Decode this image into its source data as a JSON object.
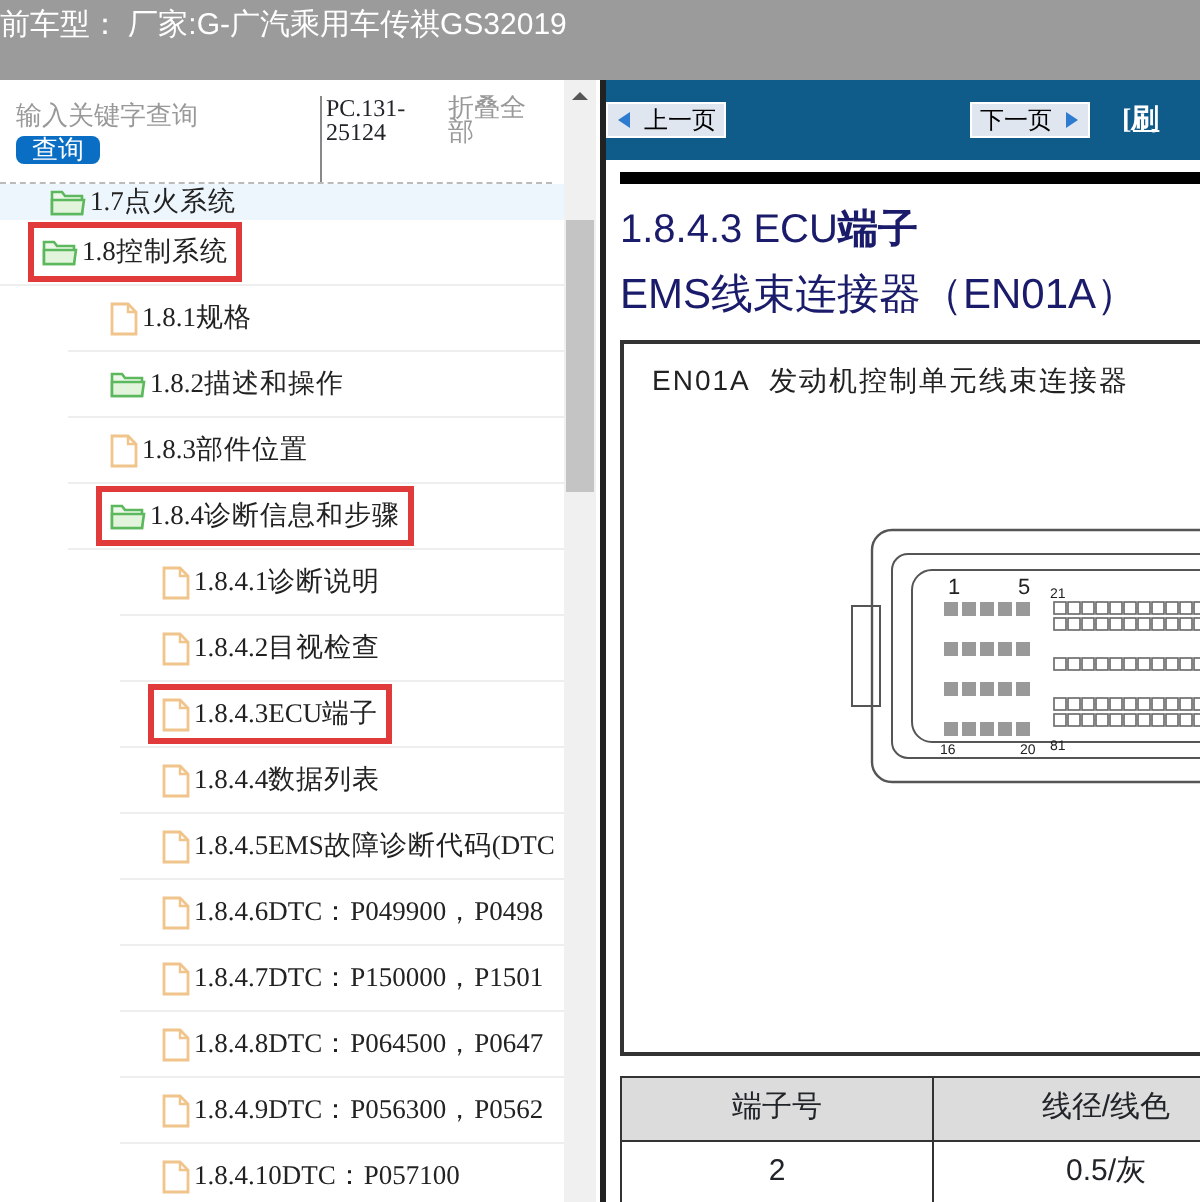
{
  "header": {
    "title": "前车型： 厂家:G-广汽乘用车传祺GS32019"
  },
  "search": {
    "placeholder": "输入关键字查询",
    "button": "查询",
    "code": "PC.131-25124",
    "collapse_link": "折叠全部"
  },
  "tree": [
    {
      "kind": "folder",
      "label": "1.7点火系统",
      "highlighted": false,
      "hovered": true
    },
    {
      "kind": "folder",
      "label": "1.8控制系统",
      "highlighted": true,
      "hovered": false,
      "children": [
        {
          "kind": "file",
          "label": "1.8.1规格",
          "highlighted": false,
          "hovered": false
        },
        {
          "kind": "folder",
          "label": "1.8.2描述和操作",
          "highlighted": false,
          "hovered": false
        },
        {
          "kind": "file",
          "label": "1.8.3部件位置",
          "highlighted": false,
          "hovered": false
        },
        {
          "kind": "folder",
          "label": "1.8.4诊断信息和步骤",
          "highlighted": true,
          "hovered": false,
          "children": [
            {
              "kind": "file",
              "label": "1.8.4.1诊断说明",
              "highlighted": false,
              "hovered": false
            },
            {
              "kind": "file",
              "label": "1.8.4.2目视检查",
              "highlighted": false,
              "hovered": false
            },
            {
              "kind": "file",
              "label": "1.8.4.3ECU端子",
              "highlighted": true,
              "hovered": false
            },
            {
              "kind": "file",
              "label": "1.8.4.4数据列表",
              "highlighted": false,
              "hovered": false
            },
            {
              "kind": "file",
              "label": "1.8.4.5EMS故障诊断代码(DTC",
              "highlighted": false,
              "hovered": false
            },
            {
              "kind": "file",
              "label": "1.8.4.6DTC：P049900，P0498",
              "highlighted": false,
              "hovered": false
            },
            {
              "kind": "file",
              "label": "1.8.4.7DTC：P150000，P1501",
              "highlighted": false,
              "hovered": false
            },
            {
              "kind": "file",
              "label": "1.8.4.8DTC：P064500，P0647",
              "highlighted": false,
              "hovered": false
            },
            {
              "kind": "file",
              "label": "1.8.4.9DTC：P056300，P0562",
              "highlighted": false,
              "hovered": false
            },
            {
              "kind": "file",
              "label": "1.8.4.10DTC：P057100",
              "highlighted": false,
              "hovered": false
            }
          ]
        }
      ]
    }
  ],
  "nav": {
    "prev": "上一页",
    "next": "下一页",
    "refresh": "[刷"
  },
  "document": {
    "section_title": "1.8.4.3 ECU**端子**",
    "connector_title": "EMS线束连接器（EN01A）",
    "figure_caption": "EN01A  发动机控制单元线束连接器",
    "pin_labels": [
      "1",
      "5",
      "21",
      "16",
      "20",
      "81"
    ],
    "table": {
      "columns": [
        "端子号",
        "线径/线色"
      ],
      "rows": [
        [
          "2",
          "0.5/灰"
        ]
      ]
    }
  }
}
